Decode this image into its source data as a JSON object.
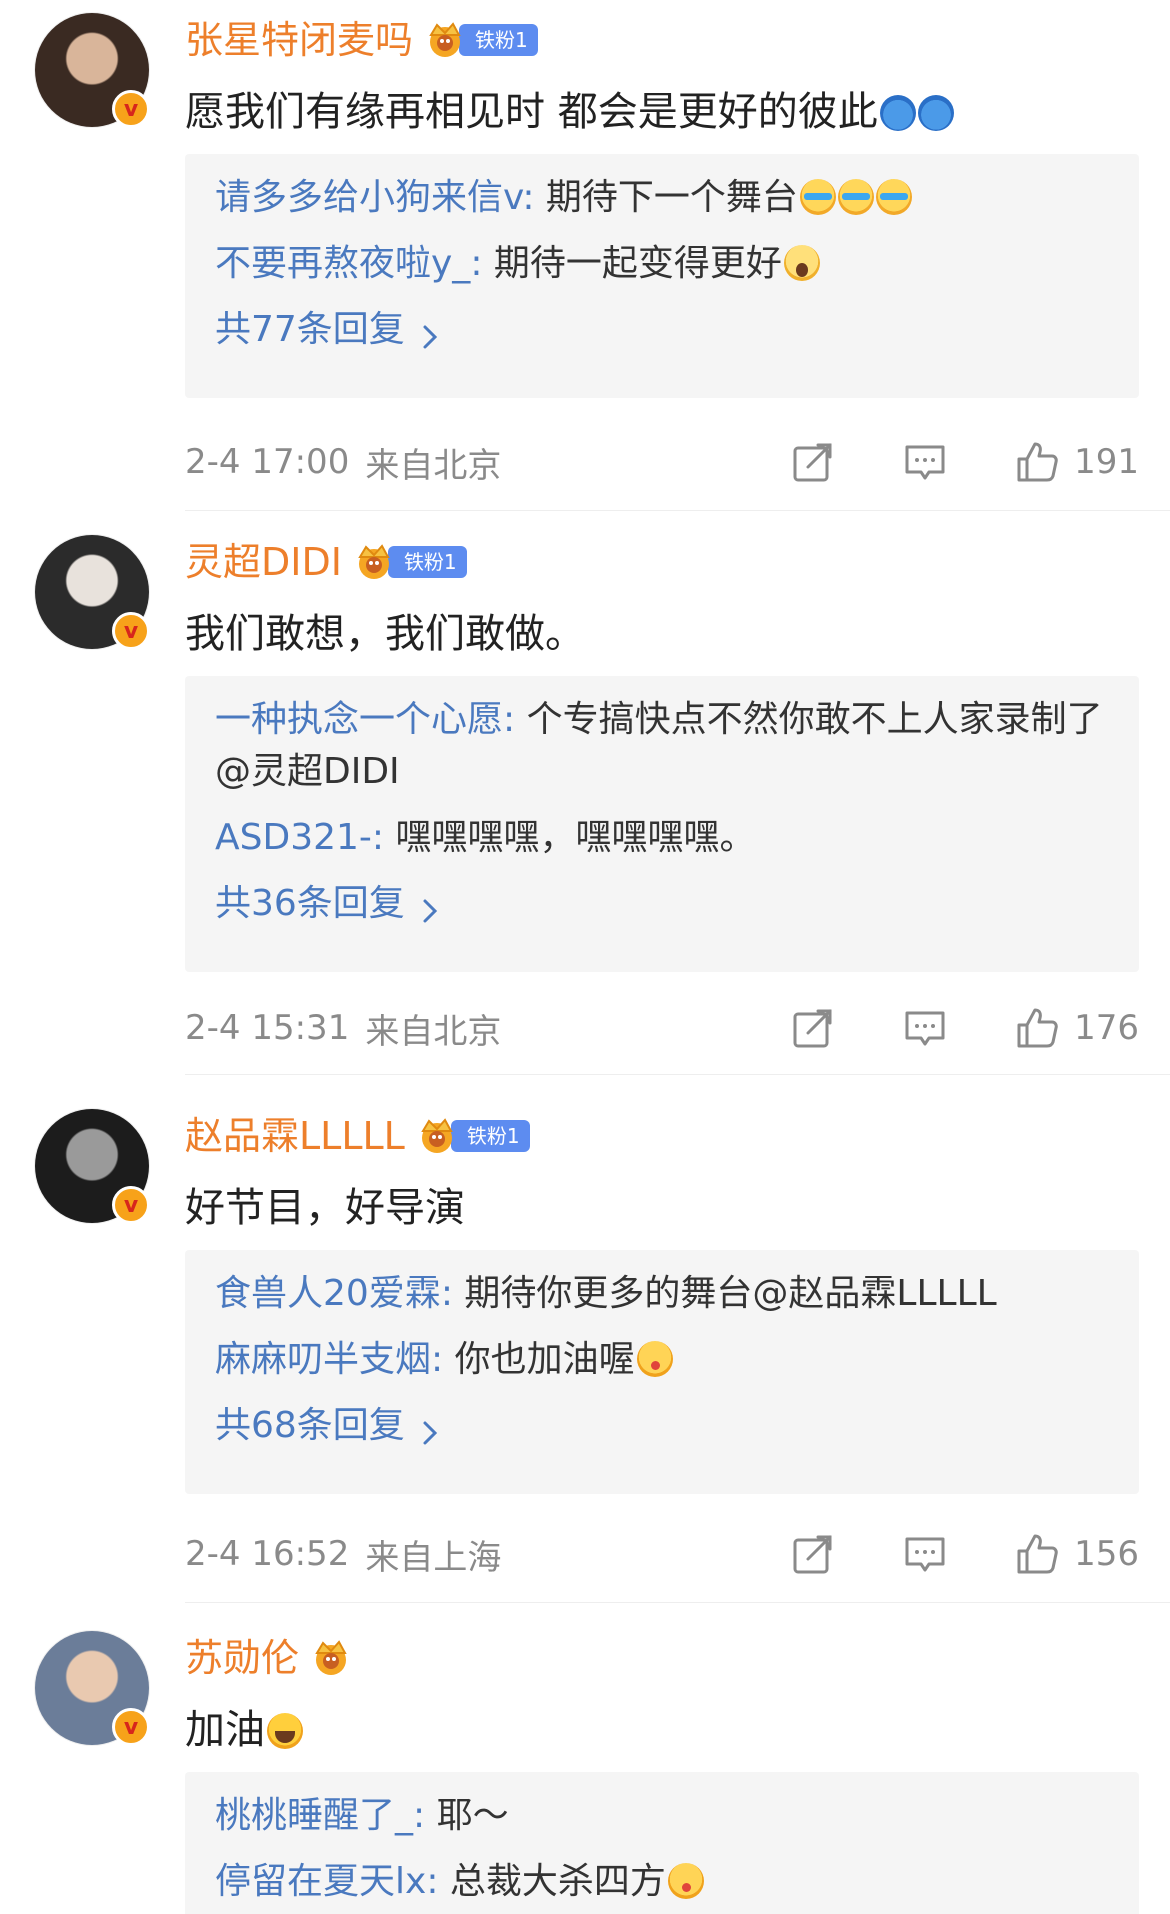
{
  "comments": [
    {
      "username": "张星特闭麦吗",
      "fan_badge": "铁粉1",
      "avatar_colors": [
        "#3a2a22",
        "#d9b59a"
      ],
      "content": "愿我们有缘再相见时 都会是更好的彼此",
      "content_emojis": [
        "wave",
        "wave"
      ],
      "replies": [
        {
          "user": "请多多给小狗来信v",
          "text": " 期待下一个舞台",
          "emojis": [
            "cry",
            "cry",
            "cry"
          ]
        },
        {
          "user": "不要再熬夜啦y_",
          "text": " 期待一起变得更好",
          "emojis": [
            "scream"
          ]
        }
      ],
      "more_replies": "共77条回复",
      "time": "2-4 17:00",
      "location": "来自北京",
      "likes": "191"
    },
    {
      "username": "灵超DIDI",
      "fan_badge": "铁粉1",
      "avatar_colors": [
        "#2b2b2b",
        "#e8e2dc"
      ],
      "content": "我们敢想，我们敢做。",
      "content_emojis": [],
      "replies": [
        {
          "user": "一种执念一个心愿",
          "text": " 个专搞快点不然你敢不上人家录制了@灵超DIDI",
          "emojis": []
        },
        {
          "user": "ASD321-",
          "text": " 嘿嘿嘿嘿，嘿嘿嘿嘿。",
          "emojis": []
        }
      ],
      "more_replies": "共36条回复",
      "time": "2-4 15:31",
      "location": "来自北京",
      "likes": "176"
    },
    {
      "username": "赵品霖LLLLL",
      "fan_badge": "铁粉1",
      "avatar_colors": [
        "#1c1c1c",
        "#9a9a9a"
      ],
      "content": "好节目，好导演",
      "content_emojis": [],
      "replies": [
        {
          "user": "食兽人20爱霖",
          "text": " 期待你更多的舞台@赵品霖LLLLL",
          "emojis": []
        },
        {
          "user": "麻麻叨半支烟",
          "text": " 你也加油喔",
          "emojis": [
            "kiss"
          ]
        }
      ],
      "more_replies": "共68条回复",
      "time": "2-4 16:52",
      "location": "来自上海",
      "likes": "156"
    },
    {
      "username": "苏勋伦",
      "fan_badge": "",
      "avatar_colors": [
        "#6b7d99",
        "#e9c9b0"
      ],
      "content": "加油",
      "content_emojis": [
        "laugh"
      ],
      "replies": [
        {
          "user": "桃桃睡醒了_",
          "text": " 耶～",
          "emojis": []
        },
        {
          "user": "停留在夏天lx",
          "text": " 总裁大杀四方",
          "emojis": [
            "kiss"
          ]
        }
      ],
      "more_replies": "",
      "time": "",
      "location": "",
      "likes": ""
    }
  ],
  "colors": {
    "username": "#ed7f2b",
    "reply_user": "#4a79bf",
    "meta": "#8a8a8a",
    "fan_badge": "#5d8cf0",
    "reply_bg": "#f5f5f5"
  },
  "icons": {
    "share": "share-icon",
    "comment": "comment-icon",
    "like": "thumbs-up-icon",
    "verified": "v-verified-icon",
    "crown": "crown-icon"
  }
}
